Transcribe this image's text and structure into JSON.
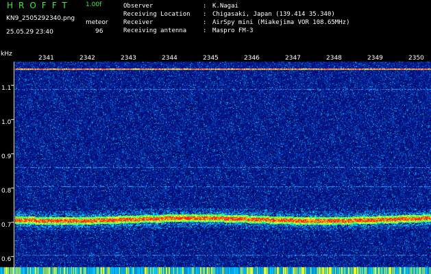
{
  "header": {
    "app_title": "HROFFT",
    "version": "1.00f",
    "filename": "KN9_2505292340.png",
    "timestamp": "25.05.29 23:40",
    "meteor_label": "meteor",
    "meteor_count": "96"
  },
  "meta": [
    {
      "key": "Observer",
      "value": "K.Nagai"
    },
    {
      "key": "Receiving Location",
      "value": "Chigasaki, Japan (139.414 35.340)"
    },
    {
      "key": "Receiver",
      "value": "AirSpy mini (Miakejima VOR 108.65MHz)"
    },
    {
      "key": "Receiving antenna",
      "value": "Maspro FM-3"
    }
  ],
  "plot": {
    "y_unit": "kHz",
    "y_ticks": [
      "1.1",
      "1.0",
      "0.9",
      "0.8",
      "0.7",
      "0.6"
    ],
    "x_ticks": [
      "2341",
      "2342",
      "2343",
      "2344",
      "2345",
      "2346",
      "2347",
      "2348",
      "2349",
      "2350"
    ],
    "colors": {
      "background": "#000000",
      "low": "#001a8c",
      "mid": "#00d0ff",
      "high": "#ffff00",
      "peak": "#ff2020",
      "text_accent": "#3ef03e"
    }
  }
}
